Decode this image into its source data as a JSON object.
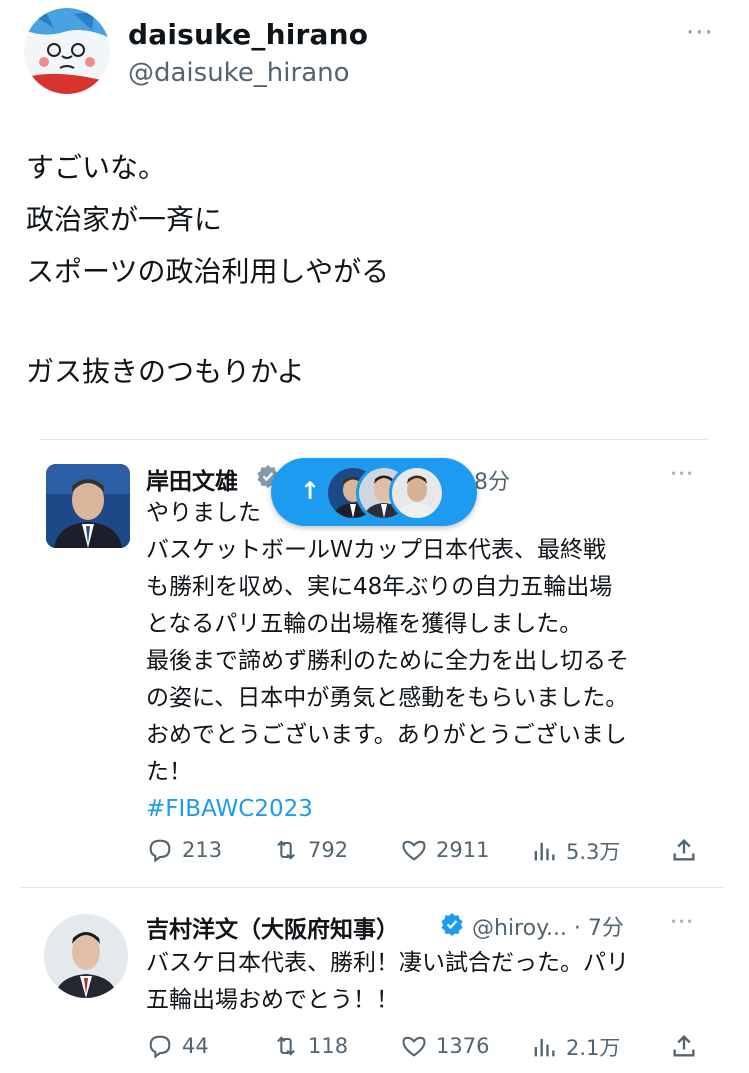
{
  "author": {
    "display_name": "daisuke_hirano",
    "handle": "@daisuke_hirano",
    "more": "···"
  },
  "post": {
    "lines": [
      "すごいな。",
      "政治家が一斉に",
      "スポーツの政治利用しやがる",
      "",
      "ガス抜きのつもりかよ"
    ]
  },
  "reply1": {
    "name": "岸田文雄",
    "time": "8分",
    "more": "···",
    "lines": [
      "やりました",
      "バスケットボールＷカップ日本代表、最終戦",
      "も勝利を収め、実に48年ぶりの自力五輪出場",
      "となるパリ五輪の出場権を獲得しました。",
      "最後まで諦めず勝利のために全力を出し切るそ",
      "の姿に、日本中が勇気と感動をもらいました。",
      "おめでとうございます。ありがとうございまし",
      "た！"
    ],
    "hashtag": "#FIBAWC2023",
    "stats": {
      "replies": "213",
      "reposts": "792",
      "likes": "2911",
      "views": "5.3万"
    }
  },
  "pill": {
    "arrow": "↑"
  },
  "reply2": {
    "name": "吉村洋文（大阪府知事）",
    "handle_time": "@hiroy... · 7分",
    "more": "···",
    "lines": [
      "バスケ日本代表、勝利！凄い試合だった。パリ",
      "五輪出場おめでとう！！"
    ],
    "stats": {
      "replies": "44",
      "reposts": "118",
      "likes": "1376",
      "views": "2.1万"
    }
  },
  "colors": {
    "accent": "#1d9bf0",
    "muted": "#536471",
    "text": "#0f1419"
  }
}
